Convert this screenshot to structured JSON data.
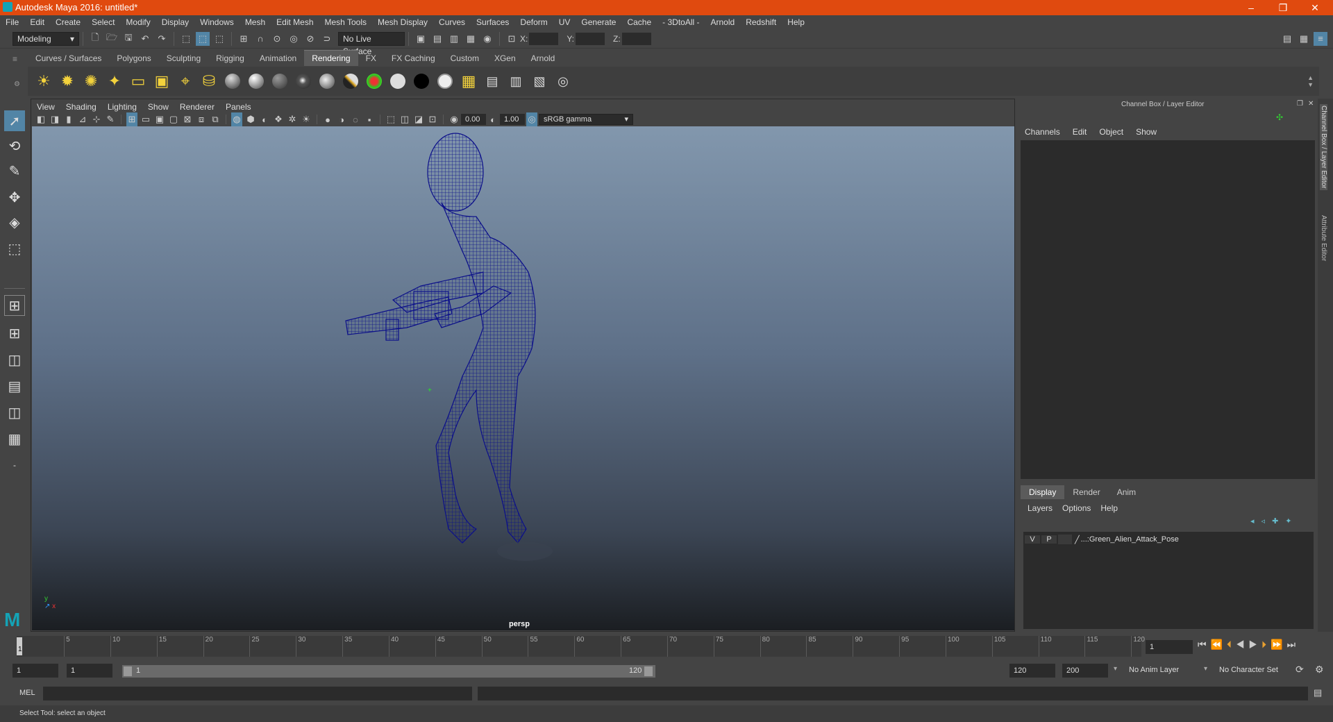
{
  "app": {
    "title": "Autodesk Maya 2016: untitled*"
  },
  "menus": [
    "File",
    "Edit",
    "Create",
    "Select",
    "Modify",
    "Display",
    "Windows",
    "Mesh",
    "Edit Mesh",
    "Mesh Tools",
    "Mesh Display",
    "Curves",
    "Surfaces",
    "Deform",
    "UV",
    "Generate",
    "Cache",
    "- 3DtoAll -",
    "Arnold",
    "Redshift",
    "Help"
  ],
  "status": {
    "mode": "Modeling",
    "live_surface": "No Live Surface",
    "x_label": "X:",
    "y_label": "Y:",
    "z_label": "Z:"
  },
  "shelf_tabs": [
    "Curves / Surfaces",
    "Polygons",
    "Sculpting",
    "Rigging",
    "Animation",
    "Rendering",
    "FX",
    "FX Caching",
    "Custom",
    "XGen",
    "Arnold"
  ],
  "viewport": {
    "menus": [
      "View",
      "Shading",
      "Lighting",
      "Show",
      "Renderer",
      "Panels"
    ],
    "exposure": "0.00",
    "gamma": "1.00",
    "color_space": "sRGB gamma",
    "camera": "persp"
  },
  "channel_box": {
    "title": "Channel Box / Layer Editor",
    "menus": [
      "Channels",
      "Edit",
      "Object",
      "Show"
    ]
  },
  "layer_editor": {
    "tabs": [
      "Display",
      "Render",
      "Anim"
    ],
    "menus": [
      "Layers",
      "Options",
      "Help"
    ],
    "layers": [
      {
        "v": "V",
        "p": "P",
        "name": "...:Green_Alien_Attack_Pose"
      }
    ]
  },
  "side_tabs": [
    "Channel Box / Layer Editor",
    "Attribute Editor"
  ],
  "timeline": {
    "ticks": [
      "5",
      "10",
      "15",
      "20",
      "25",
      "30",
      "35",
      "40",
      "45",
      "50",
      "55",
      "60",
      "65",
      "70",
      "75",
      "80",
      "85",
      "90",
      "95",
      "100",
      "105",
      "110",
      "115",
      "120"
    ],
    "start_tick": "1",
    "current_frame": "1"
  },
  "range": {
    "start": "1",
    "playback_start": "1",
    "slider_start": "1",
    "slider_end": "120",
    "playback_end": "120",
    "end": "200",
    "anim_layer": "No Anim Layer",
    "character_set": "No Character Set"
  },
  "mel": {
    "label": "MEL"
  },
  "help": {
    "text": "Select Tool: select an object"
  }
}
